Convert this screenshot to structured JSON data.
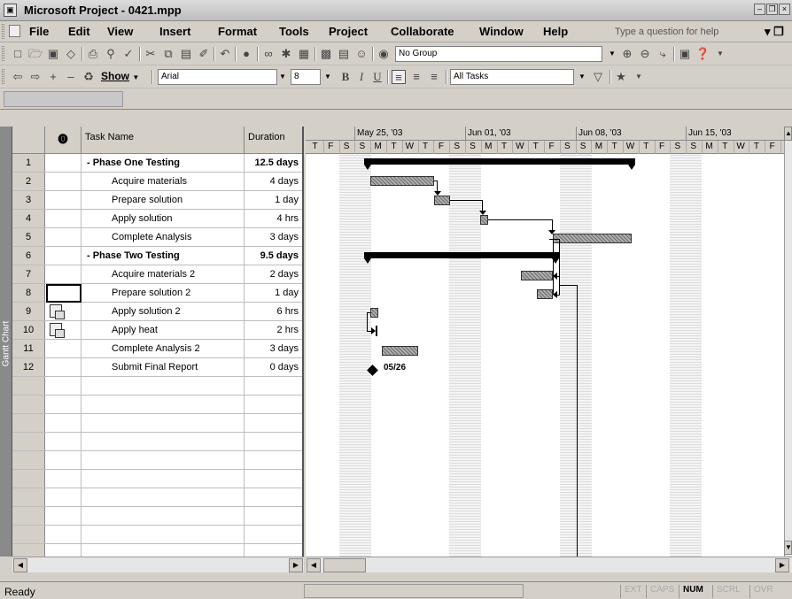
{
  "app": {
    "title": "Microsoft Project - 0421.mpp"
  },
  "menu": {
    "items": [
      "File",
      "Edit",
      "View",
      "Insert",
      "Format",
      "Tools",
      "Project",
      "Collaborate",
      "Window",
      "Help"
    ],
    "help_placeholder": "Type a question for help"
  },
  "toolbar1": {
    "group_value": "No Group"
  },
  "toolbar2": {
    "show_label": "Show",
    "font_value": "Arial",
    "size_value": "8",
    "filter_value": "All Tasks"
  },
  "grid": {
    "headers": {
      "indicators": "⓿",
      "name": "Task Name",
      "duration": "Duration"
    },
    "rows": [
      {
        "id": "1",
        "name": "- Phase One Testing",
        "duration": "12.5 days",
        "summary": true
      },
      {
        "id": "2",
        "name": "Acquire materials",
        "duration": "4 days"
      },
      {
        "id": "3",
        "name": "Prepare solution",
        "duration": "1 day"
      },
      {
        "id": "4",
        "name": "Apply solution",
        "duration": "4 hrs"
      },
      {
        "id": "5",
        "name": "Complete Analysis",
        "duration": "3 days"
      },
      {
        "id": "6",
        "name": "- Phase Two Testing",
        "duration": "9.5 days",
        "summary": true
      },
      {
        "id": "7",
        "name": "Acquire materials 2",
        "duration": "2 days"
      },
      {
        "id": "8",
        "name": "Prepare solution 2",
        "duration": "1 day"
      },
      {
        "id": "9",
        "name": "Apply solution 2",
        "duration": "6 hrs",
        "note": true
      },
      {
        "id": "10",
        "name": "Apply heat",
        "duration": "2 hrs",
        "note": true
      },
      {
        "id": "11",
        "name": "Complete Analysis 2",
        "duration": "3 days"
      },
      {
        "id": "12",
        "name": "Submit Final Report",
        "duration": "0 days"
      }
    ]
  },
  "timescale": {
    "weeks": [
      "May 25, '03",
      "Jun 01, '03",
      "Jun 08, '03",
      "Jun 15, '03"
    ],
    "days": [
      "T",
      "F",
      "S",
      "S",
      "M",
      "T",
      "W",
      "T",
      "F",
      "S",
      "S",
      "M",
      "T",
      "W",
      "T",
      "F",
      "S",
      "S",
      "M",
      "T",
      "W",
      "T",
      "F",
      "S",
      "S",
      "M",
      "T",
      "W",
      "T",
      "F"
    ]
  },
  "milestone_label": "05/26",
  "view_bar_label": "Gantt Chart",
  "status": {
    "text": "Ready",
    "indicators": [
      {
        "label": "EXT",
        "on": false
      },
      {
        "label": "CAPS",
        "on": false
      },
      {
        "label": "NUM",
        "on": true
      },
      {
        "label": "SCRL",
        "on": false
      },
      {
        "label": "OVR",
        "on": false
      }
    ]
  }
}
